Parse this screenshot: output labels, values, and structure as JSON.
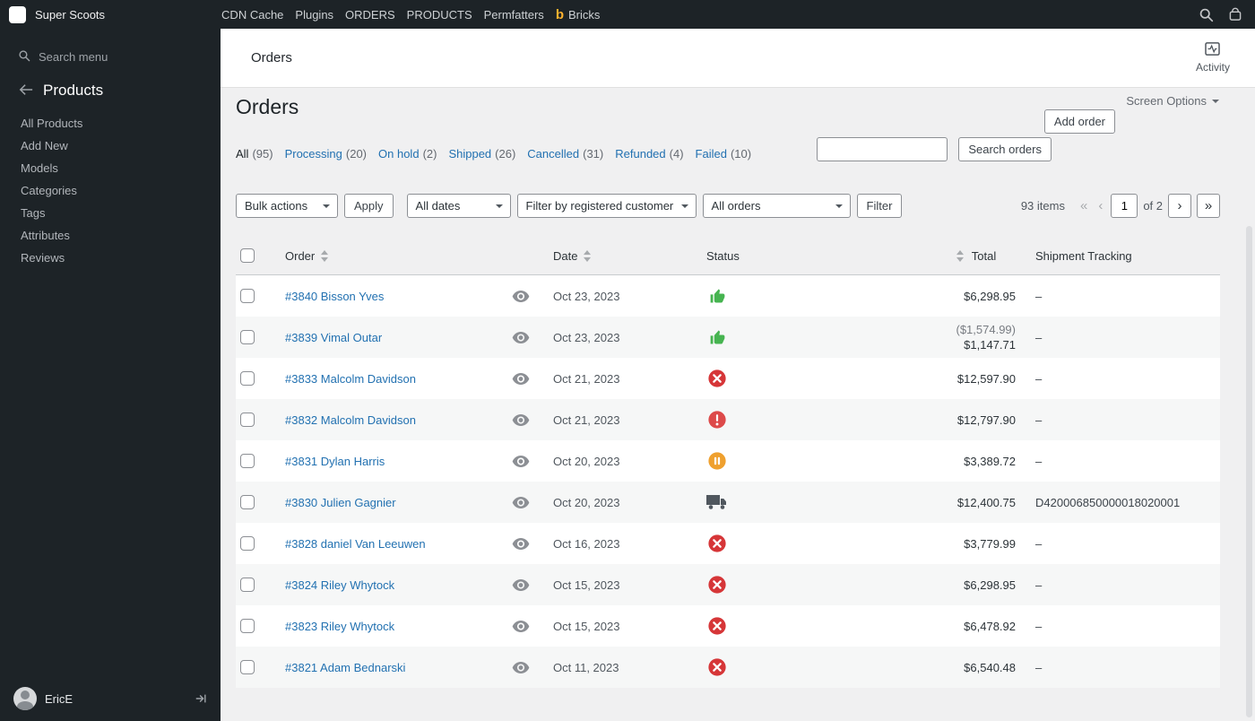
{
  "colors": {
    "accent": "#2271b1",
    "status_completed": "#46b450",
    "status_cancelled": "#d63638",
    "status_failed": "#dd4a4a",
    "status_on_hold": "#efa02e",
    "status_shipped": "#50575e"
  },
  "admin_bar": {
    "site_name": "Super Scoots",
    "menu_items": [
      "CDN Cache",
      "Plugins",
      "ORDERS",
      "PRODUCTS",
      "Permfatters"
    ],
    "bricks_logo": "b",
    "bricks_label": "Bricks"
  },
  "sidebar": {
    "search_label": "Search menu",
    "section_title": "Products",
    "items": [
      "All Products",
      "Add New",
      "Models",
      "Categories",
      "Tags",
      "Attributes",
      "Reviews"
    ],
    "user_name": "EricE"
  },
  "topbar": {
    "breadcrumb": "Orders",
    "activity_label": "Activity"
  },
  "page": {
    "title": "Orders",
    "screen_options_label": "Screen Options",
    "add_order_label": "Add order"
  },
  "status_filters": [
    {
      "label": "All",
      "count": "(95)",
      "cls": "current"
    },
    {
      "label": "Processing",
      "count": "(20)",
      "cls": "link"
    },
    {
      "label": "On hold",
      "count": "(2)",
      "cls": "link"
    },
    {
      "label": "Shipped",
      "count": "(26)",
      "cls": "link"
    },
    {
      "label": "Cancelled",
      "count": "(31)",
      "cls": "link"
    },
    {
      "label": "Refunded",
      "count": "(4)",
      "cls": "link"
    },
    {
      "label": "Failed",
      "count": "(10)",
      "cls": "link"
    }
  ],
  "search": {
    "value": "",
    "button_label": "Search orders"
  },
  "filters": {
    "bulk_actions_label": "Bulk actions",
    "apply_label": "Apply",
    "all_dates_label": "All dates",
    "customer_filter_label": "Filter by registered customer",
    "all_orders_label": "All orders",
    "filter_label": "Filter"
  },
  "pagination": {
    "items_count": "93 items",
    "first": "«",
    "prev": "‹",
    "current_page": "1",
    "of_label": "of 2",
    "next": "›",
    "last": "»"
  },
  "table": {
    "columns": {
      "order": "Order",
      "date": "Date",
      "status": "Status",
      "total": "Total",
      "tracking": "Shipment Tracking"
    },
    "rows": [
      {
        "order": "#3840 Bisson Yves",
        "date": "Oct 23, 2023",
        "status": "completed",
        "total": "$6,298.95",
        "tracking": "–"
      },
      {
        "order": "#3839 Vimal Outar",
        "date": "Oct 23, 2023",
        "status": "completed",
        "refund": "($1,574.99)",
        "total": "$1,147.71",
        "tracking": "–"
      },
      {
        "order": "#3833 Malcolm Davidson",
        "date": "Oct 21, 2023",
        "status": "cancelled",
        "total": "$12,597.90",
        "tracking": "–"
      },
      {
        "order": "#3832 Malcolm Davidson",
        "date": "Oct 21, 2023",
        "status": "failed",
        "total": "$12,797.90",
        "tracking": "–"
      },
      {
        "order": "#3831 Dylan Harris",
        "date": "Oct 20, 2023",
        "status": "on-hold",
        "total": "$3,389.72",
        "tracking": "–"
      },
      {
        "order": "#3830 Julien Gagnier",
        "date": "Oct 20, 2023",
        "status": "shipped",
        "total": "$12,400.75",
        "tracking": "D420006850000018020001"
      },
      {
        "order": "#3828 daniel Van Leeuwen",
        "date": "Oct 16, 2023",
        "status": "cancelled",
        "total": "$3,779.99",
        "tracking": "–"
      },
      {
        "order": "#3824 Riley Whytock",
        "date": "Oct 15, 2023",
        "status": "cancelled",
        "total": "$6,298.95",
        "tracking": "–"
      },
      {
        "order": "#3823 Riley Whytock",
        "date": "Oct 15, 2023",
        "status": "cancelled",
        "total": "$6,478.92",
        "tracking": "–"
      },
      {
        "order": "#3821 Adam Bednarski",
        "date": "Oct 11, 2023",
        "status": "cancelled",
        "total": "$6,540.48",
        "tracking": "–"
      }
    ]
  }
}
